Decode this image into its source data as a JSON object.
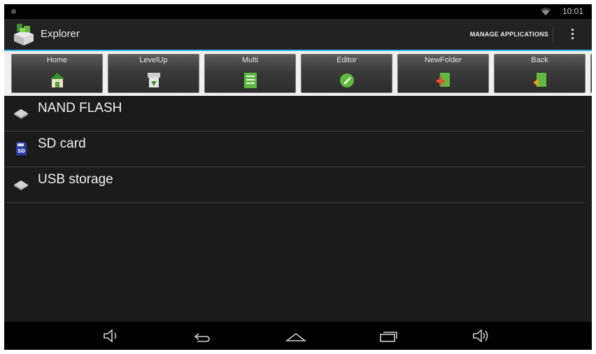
{
  "status_bar": {
    "time": "10:01"
  },
  "action_bar": {
    "title": "Explorer",
    "manage_label": "MANAGE APPLICATIONS"
  },
  "toolbar": {
    "buttons": [
      {
        "label": "Home",
        "icon": "home-icon"
      },
      {
        "label": "LevelUp",
        "icon": "level-up-icon"
      },
      {
        "label": "Multi",
        "icon": "multi-icon"
      },
      {
        "label": "Editor",
        "icon": "editor-icon"
      },
      {
        "label": "NewFolder",
        "icon": "new-folder-icon"
      },
      {
        "label": "Back",
        "icon": "back-icon"
      }
    ]
  },
  "storage": {
    "items": [
      {
        "label": "NAND FLASH",
        "icon": "drive-icon"
      },
      {
        "label": "SD card",
        "icon": "sd-card-icon"
      },
      {
        "label": "USB storage",
        "icon": "drive-icon"
      }
    ]
  },
  "navigation": {
    "buttons": [
      "volume-down-icon",
      "back-icon",
      "home-icon",
      "recent-apps-icon",
      "volume-up-icon"
    ]
  },
  "colors": {
    "accent": "#33b5e5",
    "background": "#1b1b1b"
  }
}
